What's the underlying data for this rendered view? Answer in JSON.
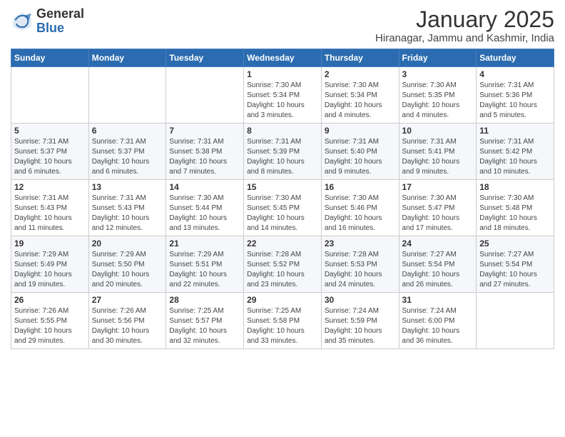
{
  "logo": {
    "general": "General",
    "blue": "Blue"
  },
  "header": {
    "month_year": "January 2025",
    "location": "Hiranagar, Jammu and Kashmir, India"
  },
  "weekdays": [
    "Sunday",
    "Monday",
    "Tuesday",
    "Wednesday",
    "Thursday",
    "Friday",
    "Saturday"
  ],
  "weeks": [
    [
      {
        "day": "",
        "info": ""
      },
      {
        "day": "",
        "info": ""
      },
      {
        "day": "",
        "info": ""
      },
      {
        "day": "1",
        "info": "Sunrise: 7:30 AM\nSunset: 5:34 PM\nDaylight: 10 hours\nand 3 minutes."
      },
      {
        "day": "2",
        "info": "Sunrise: 7:30 AM\nSunset: 5:34 PM\nDaylight: 10 hours\nand 4 minutes."
      },
      {
        "day": "3",
        "info": "Sunrise: 7:30 AM\nSunset: 5:35 PM\nDaylight: 10 hours\nand 4 minutes."
      },
      {
        "day": "4",
        "info": "Sunrise: 7:31 AM\nSunset: 5:36 PM\nDaylight: 10 hours\nand 5 minutes."
      }
    ],
    [
      {
        "day": "5",
        "info": "Sunrise: 7:31 AM\nSunset: 5:37 PM\nDaylight: 10 hours\nand 6 minutes."
      },
      {
        "day": "6",
        "info": "Sunrise: 7:31 AM\nSunset: 5:37 PM\nDaylight: 10 hours\nand 6 minutes."
      },
      {
        "day": "7",
        "info": "Sunrise: 7:31 AM\nSunset: 5:38 PM\nDaylight: 10 hours\nand 7 minutes."
      },
      {
        "day": "8",
        "info": "Sunrise: 7:31 AM\nSunset: 5:39 PM\nDaylight: 10 hours\nand 8 minutes."
      },
      {
        "day": "9",
        "info": "Sunrise: 7:31 AM\nSunset: 5:40 PM\nDaylight: 10 hours\nand 9 minutes."
      },
      {
        "day": "10",
        "info": "Sunrise: 7:31 AM\nSunset: 5:41 PM\nDaylight: 10 hours\nand 9 minutes."
      },
      {
        "day": "11",
        "info": "Sunrise: 7:31 AM\nSunset: 5:42 PM\nDaylight: 10 hours\nand 10 minutes."
      }
    ],
    [
      {
        "day": "12",
        "info": "Sunrise: 7:31 AM\nSunset: 5:43 PM\nDaylight: 10 hours\nand 11 minutes."
      },
      {
        "day": "13",
        "info": "Sunrise: 7:31 AM\nSunset: 5:43 PM\nDaylight: 10 hours\nand 12 minutes."
      },
      {
        "day": "14",
        "info": "Sunrise: 7:30 AM\nSunset: 5:44 PM\nDaylight: 10 hours\nand 13 minutes."
      },
      {
        "day": "15",
        "info": "Sunrise: 7:30 AM\nSunset: 5:45 PM\nDaylight: 10 hours\nand 14 minutes."
      },
      {
        "day": "16",
        "info": "Sunrise: 7:30 AM\nSunset: 5:46 PM\nDaylight: 10 hours\nand 16 minutes."
      },
      {
        "day": "17",
        "info": "Sunrise: 7:30 AM\nSunset: 5:47 PM\nDaylight: 10 hours\nand 17 minutes."
      },
      {
        "day": "18",
        "info": "Sunrise: 7:30 AM\nSunset: 5:48 PM\nDaylight: 10 hours\nand 18 minutes."
      }
    ],
    [
      {
        "day": "19",
        "info": "Sunrise: 7:29 AM\nSunset: 5:49 PM\nDaylight: 10 hours\nand 19 minutes."
      },
      {
        "day": "20",
        "info": "Sunrise: 7:29 AM\nSunset: 5:50 PM\nDaylight: 10 hours\nand 20 minutes."
      },
      {
        "day": "21",
        "info": "Sunrise: 7:29 AM\nSunset: 5:51 PM\nDaylight: 10 hours\nand 22 minutes."
      },
      {
        "day": "22",
        "info": "Sunrise: 7:28 AM\nSunset: 5:52 PM\nDaylight: 10 hours\nand 23 minutes."
      },
      {
        "day": "23",
        "info": "Sunrise: 7:28 AM\nSunset: 5:53 PM\nDaylight: 10 hours\nand 24 minutes."
      },
      {
        "day": "24",
        "info": "Sunrise: 7:27 AM\nSunset: 5:54 PM\nDaylight: 10 hours\nand 26 minutes."
      },
      {
        "day": "25",
        "info": "Sunrise: 7:27 AM\nSunset: 5:54 PM\nDaylight: 10 hours\nand 27 minutes."
      }
    ],
    [
      {
        "day": "26",
        "info": "Sunrise: 7:26 AM\nSunset: 5:55 PM\nDaylight: 10 hours\nand 29 minutes."
      },
      {
        "day": "27",
        "info": "Sunrise: 7:26 AM\nSunset: 5:56 PM\nDaylight: 10 hours\nand 30 minutes."
      },
      {
        "day": "28",
        "info": "Sunrise: 7:25 AM\nSunset: 5:57 PM\nDaylight: 10 hours\nand 32 minutes."
      },
      {
        "day": "29",
        "info": "Sunrise: 7:25 AM\nSunset: 5:58 PM\nDaylight: 10 hours\nand 33 minutes."
      },
      {
        "day": "30",
        "info": "Sunrise: 7:24 AM\nSunset: 5:59 PM\nDaylight: 10 hours\nand 35 minutes."
      },
      {
        "day": "31",
        "info": "Sunrise: 7:24 AM\nSunset: 6:00 PM\nDaylight: 10 hours\nand 36 minutes."
      },
      {
        "day": "",
        "info": ""
      }
    ]
  ]
}
